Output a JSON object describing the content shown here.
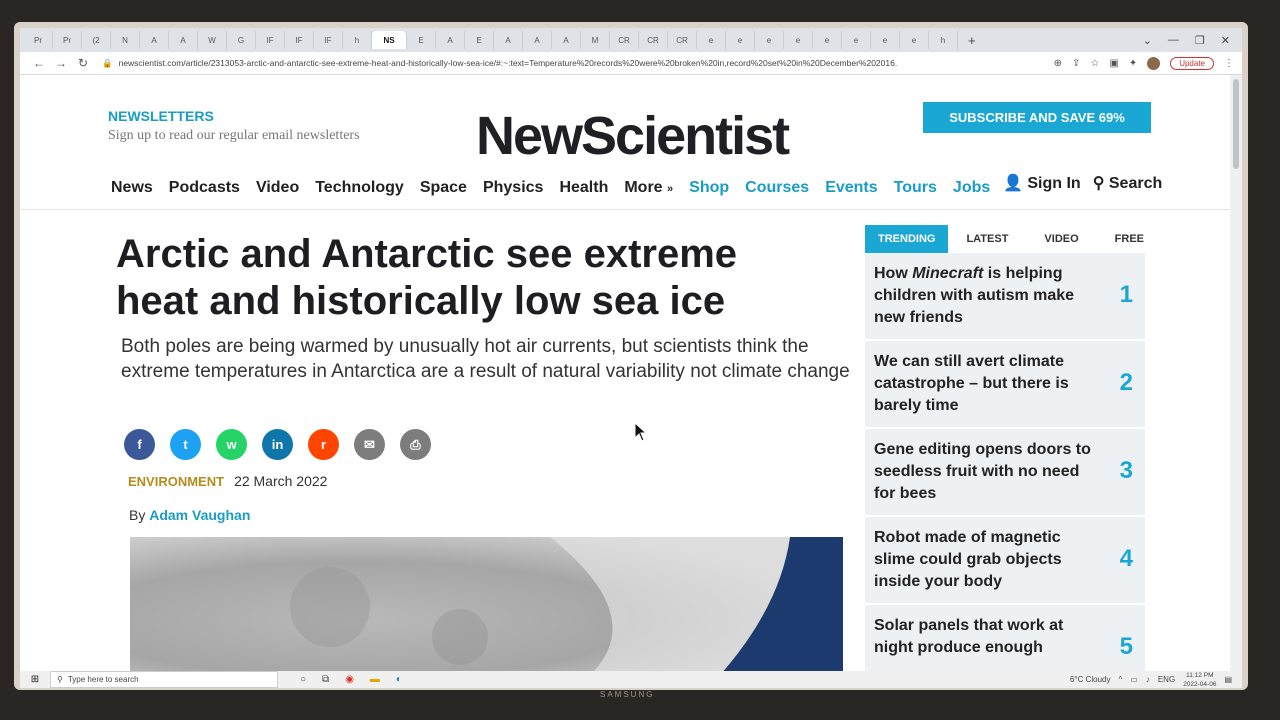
{
  "browser": {
    "tabs": [
      "Pr",
      "Pr",
      "(2",
      "N",
      "A",
      "A",
      "W",
      "G",
      "IF",
      "IF",
      "IF",
      "h",
      "NS",
      "E",
      "A",
      "E",
      "A",
      "A",
      "A",
      "M",
      "CR",
      "CR",
      "CR",
      "e",
      "e",
      "e",
      "e",
      "e",
      "e",
      "e",
      "e",
      "h"
    ],
    "active_tab": "NS",
    "url": "newscientist.com/article/2313053-arctic-and-antarctic-see-extreme-heat-and-historically-low-sea-ice/#:~:text=Temperature%20records%20were%20broken%20in,record%20set%20in%20December%202016.",
    "update_label": "Update",
    "new_tab": "+"
  },
  "header": {
    "newsletters_title": "NEWSLETTERS",
    "newsletters_sub": "Sign up to read our regular email newsletters",
    "logo": "NewScientist",
    "subscribe": "SUBSCRIBE AND SAVE 69%"
  },
  "nav": {
    "items": [
      "News",
      "Podcasts",
      "Video",
      "Technology",
      "Space",
      "Physics",
      "Health",
      "More"
    ],
    "blue_items": [
      "Shop",
      "Courses",
      "Events",
      "Tours",
      "Jobs"
    ],
    "sign_in": "Sign In",
    "search": "Search"
  },
  "article": {
    "headline": "Arctic and Antarctic see extreme heat and historically low sea ice",
    "standfirst": "Both poles are being warmed by unusually hot air currents, but scientists think the extreme temperatures in Antarctica are a result of natural variability not climate change",
    "category": "ENVIRONMENT",
    "date": "22 March 2022",
    "by": "By",
    "author": "Adam Vaughan"
  },
  "share": [
    {
      "icon": "facebook-icon",
      "glyph": "f",
      "color": "#3b5998"
    },
    {
      "icon": "twitter-icon",
      "glyph": "t",
      "color": "#1da1f2"
    },
    {
      "icon": "whatsapp-icon",
      "glyph": "w",
      "color": "#25d366"
    },
    {
      "icon": "linkedin-icon",
      "glyph": "in",
      "color": "#0e76a8"
    },
    {
      "icon": "reddit-icon",
      "glyph": "r",
      "color": "#ff4500"
    },
    {
      "icon": "email-icon",
      "glyph": "✉",
      "color": "#7d7d7d"
    },
    {
      "icon": "print-icon",
      "glyph": "⎙",
      "color": "#7d7d7d"
    }
  ],
  "trending": {
    "tabs": [
      "TRENDING",
      "LATEST",
      "VIDEO",
      "FREE"
    ],
    "items": [
      {
        "pre": "How ",
        "em": "Minecraft",
        "post": " is helping children with autism make new friends",
        "num": "1"
      },
      {
        "pre": "We can still avert climate catastrophe – but there is barely time",
        "em": "",
        "post": "",
        "num": "2"
      },
      {
        "pre": "Gene editing opens doors to seedless fruit with no need for bees",
        "em": "",
        "post": "",
        "num": "3"
      },
      {
        "pre": "Robot made of magnetic slime could grab objects inside your body",
        "em": "",
        "post": "",
        "num": "4"
      },
      {
        "pre": "Solar panels that work at night produce enough",
        "em": "",
        "post": "",
        "num": "5"
      }
    ]
  },
  "taskbar": {
    "search_placeholder": "Type here to search",
    "weather": "6°C  Cloudy",
    "lang": "ENG",
    "time": "11:12 PM",
    "date": "2022-04-06"
  },
  "monitor_brand": "SAMSUNG",
  "colors": {
    "accent": "#1ba7d4",
    "category": "#b58c1b",
    "headline": "#1e1e22"
  }
}
